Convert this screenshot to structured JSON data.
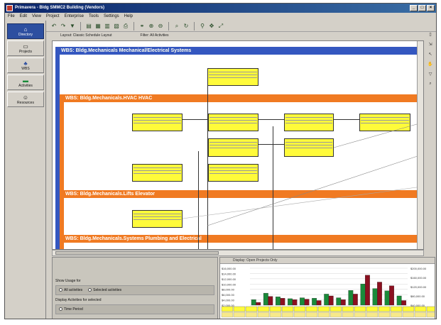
{
  "window": {
    "title": "Primavera - Bldg SMMC2 Building (Vendors)",
    "controls": [
      "_",
      "□",
      "×"
    ]
  },
  "menu": [
    "File",
    "Edit",
    "View",
    "Project",
    "Enterprise",
    "Tools",
    "Settings",
    "Help"
  ],
  "toolbar_icons": [
    "undo-icon",
    "redo-icon",
    "filter-icon",
    "sep",
    "layout-icon",
    "grid-icon",
    "columns-icon",
    "bars-icon",
    "print-icon",
    "sep",
    "link-icon",
    "zoom-in-icon",
    "zoom-out-icon",
    "sep",
    "find-icon",
    "refresh-icon",
    "sep",
    "zoom-icon",
    "pan-icon",
    "fit-icon"
  ],
  "sidebar": [
    {
      "label": "Directory",
      "icon": "home-icon",
      "active": true
    },
    {
      "label": "Projects",
      "icon": "folder-icon",
      "active": false
    },
    {
      "label": "WBS",
      "icon": "wbs-icon",
      "active": false
    },
    {
      "label": "Activities",
      "icon": "bars-icon",
      "active": false
    },
    {
      "label": "Resources",
      "icon": "people-icon",
      "active": false
    }
  ],
  "layout_bar": {
    "layout": "Layout: Classic Schedule Layout",
    "filter": "Filter: All Activities"
  },
  "wbs": [
    {
      "label": "WBS: Bldg.Mechanicals Mechanical/Electrical Systems",
      "color": "#3457c0"
    },
    {
      "label": "WBS: Bldg.Mechanicals.HVAC HVAC",
      "color": "#f07a22"
    },
    {
      "label": "WBS: Bldg.Mechanicals.Lifts Elevator",
      "color": "#f07a22"
    },
    {
      "label": "WBS: Bldg.Mechanicals.Systems Plumbing and Electrical",
      "color": "#f07a22"
    }
  ],
  "bottom_left": {
    "show_usage_label": "Show Usage for",
    "option_all": "All activities",
    "option_selected": "Selected activities",
    "display_label": "Display Activities for selected",
    "option_time": "Time Period"
  },
  "chart_panel": {
    "header": "Display: Open Projects Only",
    "left_axis": [
      "$16,000.00",
      "$14,000.00",
      "$12,000.00",
      "$10,000.00",
      "$8,000.00",
      "$6,000.00",
      "$4,000.00",
      "$2,000.00"
    ],
    "right_axis": [
      "$200,000.00",
      "$160,000.00",
      "$120,000.00",
      "$80,000.00",
      "$40,000.00"
    ]
  },
  "chart_data": {
    "type": "bar",
    "series": [
      {
        "values": [
          1.2,
          2.6,
          1.8,
          1.4,
          1.6,
          1.5,
          2.4,
          1.6,
          3.2,
          4.6,
          3.6,
          3.1,
          2.0
        ]
      },
      {
        "values": [
          0.6,
          1.9,
          1.5,
          1.2,
          1.3,
          1.0,
          2.0,
          1.2,
          2.4,
          6.5,
          5.0,
          4.2,
          1.0
        ]
      }
    ],
    "colors": {
      "series1": "#1a8a3a",
      "series2": "#8b1020"
    }
  }
}
